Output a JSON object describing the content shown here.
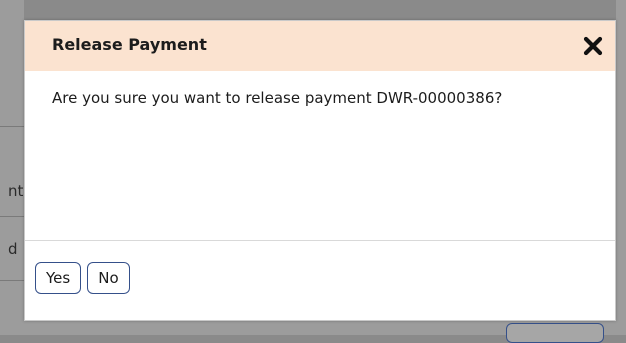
{
  "background": {
    "fragment_1": "nt",
    "fragment_2": "d"
  },
  "dialog": {
    "title": "Release Payment",
    "close_icon": "close-icon",
    "message": "Are you sure you want to release payment DWR-00000386?",
    "buttons": {
      "yes_label": "Yes",
      "no_label": "No"
    }
  },
  "colors": {
    "header_bg": "#fbe3d0",
    "button_border": "#35508a",
    "overlay": "#8a8a8a"
  }
}
